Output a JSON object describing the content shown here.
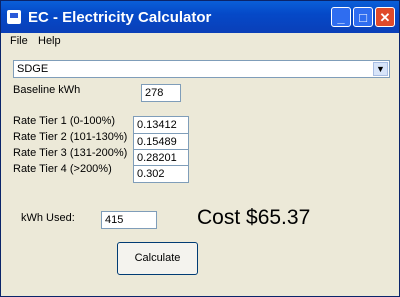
{
  "window": {
    "title": "EC - Electricity Calculator"
  },
  "menu": {
    "file": "File",
    "help": "Help"
  },
  "provider": {
    "selected": "SDGE"
  },
  "baseline": {
    "label": "Baseline kWh",
    "value": "278"
  },
  "tiers": [
    {
      "label": "Rate Tier 1 (0-100%)",
      "value": "0.13412"
    },
    {
      "label": "Rate Tier 2 (101-130%)",
      "value": "0.15489"
    },
    {
      "label": "Rate Tier 3 (131-200%)",
      "value": "0.28201"
    },
    {
      "label": "Rate Tier 4 (>200%)",
      "value": "0.302"
    }
  ],
  "usage": {
    "label": "kWh Used:",
    "value": "415"
  },
  "result": {
    "cost": "Cost $65.37"
  },
  "actions": {
    "calculate": "Calculate"
  },
  "icons": {
    "app": "app-icon",
    "minimize": "minimize-icon",
    "maximize": "maximize-icon",
    "close": "close-icon",
    "dropdown": "chevron-down-icon"
  }
}
